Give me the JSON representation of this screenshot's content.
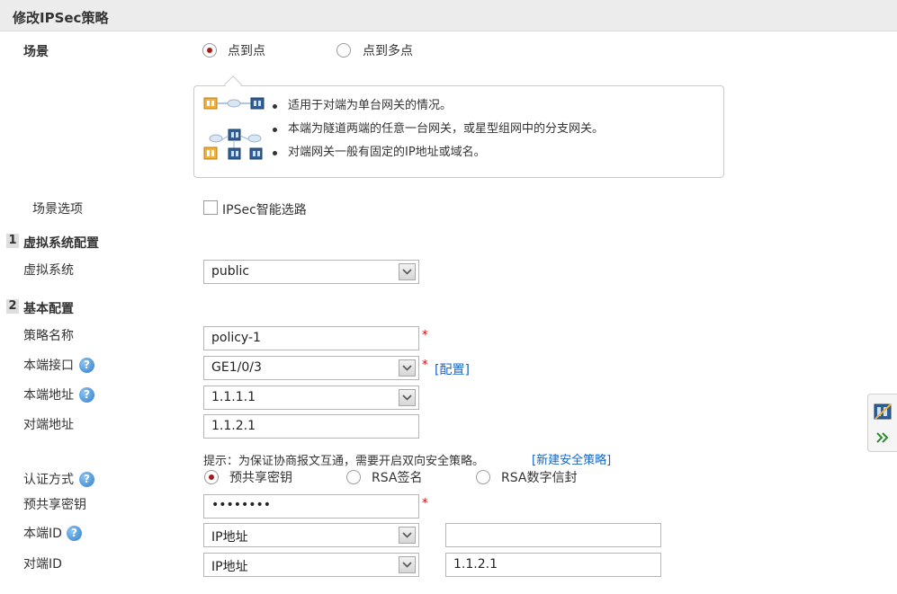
{
  "page": {
    "title": "修改IPSec策略"
  },
  "scene": {
    "label": "场景",
    "options": [
      "点到点",
      "点到多点"
    ],
    "selected": 0,
    "info_bullets": [
      "适用于对端为单台网关的情况。",
      "本端为隧道两端的任意一台网关，或星型组网中的分支网关。",
      "对端网关一般有固定的IP地址或域名。"
    ]
  },
  "scene_options": {
    "label": "场景选项",
    "checkbox_label": "IPSec智能选路",
    "checked": false
  },
  "section1": {
    "num": "1",
    "title": "虚拟系统配置",
    "vsys_label": "虚拟系统",
    "vsys_value": "public"
  },
  "section2": {
    "num": "2",
    "title": "基本配置",
    "policy_name_label": "策略名称",
    "policy_name_value": "policy-1",
    "local_iface_label": "本端接口",
    "local_iface_value": "GE1/0/3",
    "config_link": "[配置]",
    "local_addr_label": "本端地址",
    "local_addr_value": "1.1.1.1",
    "peer_addr_label": "对端地址",
    "peer_addr_value": "1.1.2.1",
    "hint_text": "提示：为保证协商报文互通，需要开启双向安全策略。",
    "new_policy_link": "[新建安全策略]",
    "auth_label": "认证方式",
    "auth_options": [
      "预共享密钥",
      "RSA签名",
      "RSA数字信封"
    ],
    "auth_selected": 0,
    "psk_label": "预共享密钥",
    "psk_value": "••••••••",
    "local_id_label": "本端ID",
    "local_id_type": "IP地址",
    "local_id_value": "",
    "peer_id_label": "对端ID",
    "peer_id_type": "IP地址",
    "peer_id_value": "1.1.2.1"
  },
  "common": {
    "required_mark": "*",
    "help_mark": "?"
  },
  "colors": {
    "accent_radio": "#a81b1b",
    "link": "#1466c4",
    "required": "#dd0000",
    "header_bg": "#ececec"
  }
}
